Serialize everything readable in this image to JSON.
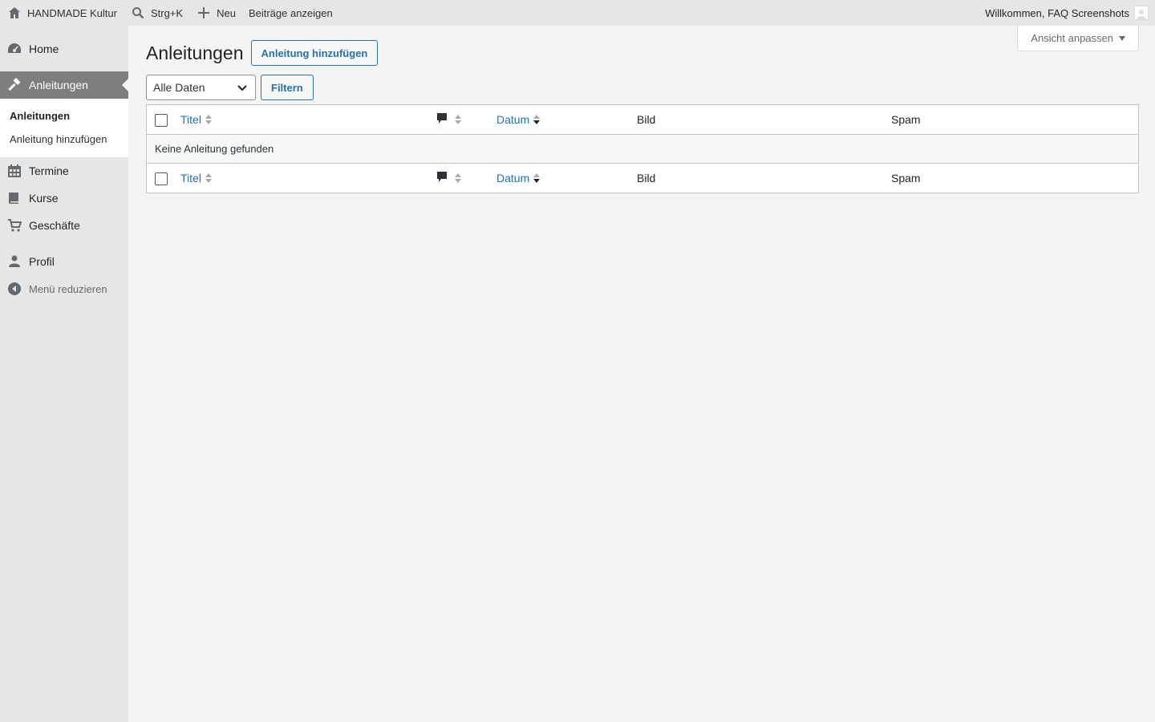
{
  "adminbar": {
    "site_name": "HANDMADE Kultur",
    "search_shortcut": "Strg+K",
    "new_label": "Neu",
    "view_posts": "Beiträge anzeigen",
    "welcome": "Willkommen, FAQ Screenshots",
    "icons": [
      "home-icon",
      "search-icon",
      "plus-icon",
      "avatar"
    ]
  },
  "sidebar": {
    "items": [
      {
        "label": "Home",
        "icon": "dashboard-icon"
      },
      {
        "label": "Anleitungen",
        "icon": "hammer-icon",
        "current": true
      },
      {
        "label": "Termine",
        "icon": "calendar-icon"
      },
      {
        "label": "Kurse",
        "icon": "book-icon"
      },
      {
        "label": "Geschäfte",
        "icon": "cart-icon"
      },
      {
        "label": "Profil",
        "icon": "user-icon"
      }
    ],
    "submenu": [
      {
        "label": "Anleitungen",
        "active": true
      },
      {
        "label": "Anleitung hinzufügen"
      }
    ],
    "collapse_label": "Menü reduzieren"
  },
  "screen_options": {
    "label": "Ansicht anpassen"
  },
  "main": {
    "title": "Anleitungen",
    "add_button": "Anleitung hinzufügen",
    "date_filter": {
      "selected": "Alle Daten"
    },
    "filter_button": "Filtern",
    "columns": {
      "title": "Titel",
      "date": "Datum",
      "image": "Bild",
      "spam": "Spam",
      "comments_icon": "comment-icon"
    },
    "empty_message": "Keine Anleitung gefunden"
  },
  "colors": {
    "accent": "#2271b1",
    "current_menu_bg": "#7e7e7e",
    "sidebar_bg": "#e6e6e6",
    "page_bg": "#f4f4f4"
  }
}
